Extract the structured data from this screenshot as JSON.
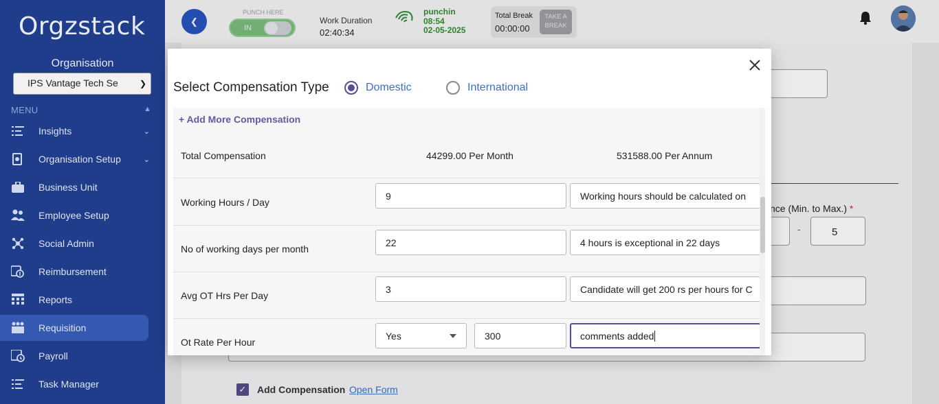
{
  "sidebar": {
    "logo": "Orgzstack",
    "org_label": "Organisation",
    "org_select_value": "IPS Vantage Tech Se",
    "menu_label": "MENU",
    "items": [
      {
        "label": "Insights",
        "icon": "list-icon",
        "has_chevron": true
      },
      {
        "label": "Organisation Setup",
        "icon": "org-setup-icon",
        "has_chevron": true
      },
      {
        "label": "Business Unit",
        "icon": "briefcase-icon",
        "has_chevron": false
      },
      {
        "label": "Employee Setup",
        "icon": "people-icon",
        "has_chevron": false
      },
      {
        "label": "Social Admin",
        "icon": "social-icon",
        "has_chevron": false
      },
      {
        "label": "Reimbursement",
        "icon": "reimbursement-icon",
        "has_chevron": false
      },
      {
        "label": "Reports",
        "icon": "grid-icon",
        "has_chevron": false
      },
      {
        "label": "Requisition",
        "icon": "requisition-icon",
        "has_chevron": false,
        "active": true
      },
      {
        "label": "Payroll",
        "icon": "payroll-icon",
        "has_chevron": false
      },
      {
        "label": "Task Manager",
        "icon": "task-icon",
        "has_chevron": false
      }
    ]
  },
  "header": {
    "punch_label": "PUNCH HERE",
    "punch_state": "IN",
    "work_duration_label": "Work Duration",
    "work_duration_value": "02:40:34",
    "punchin_label": "punchin",
    "punchin_time": "08:54",
    "punchin_date": "02-05-2025",
    "total_break_label": "Total Break",
    "total_break_value": "00:00:00",
    "take_break_line1": "TAKE A",
    "take_break_line2": "BREAK"
  },
  "background": {
    "range_label": "nce (Min. to Max.)",
    "range_required": "*",
    "range_separator": "-",
    "range_max": "5",
    "add_compensation_label": "Add Compensation",
    "open_form_link": "Open Form"
  },
  "modal": {
    "title": "Select Compensation Type",
    "options": [
      {
        "label": "Domestic",
        "selected": true
      },
      {
        "label": "International",
        "selected": false
      }
    ],
    "add_more": "+ Add More Compensation",
    "total": {
      "label": "Total Compensation",
      "per_month": "44299.00 Per Month",
      "per_annum": "531588.00 Per Annum"
    },
    "rows": [
      {
        "label": "Working Hours / Day",
        "value": "9",
        "comment": "Working hours should be calculated on"
      },
      {
        "label": "No of working days per month",
        "value": "22",
        "comment": "4 hours is exceptional in 22 days"
      },
      {
        "label": "Avg OT Hrs Per Day",
        "value": "3",
        "comment": "Candidate will get 200 rs per hours for C"
      },
      {
        "label": "Ot Rate Per Hour",
        "select_value": "Yes",
        "value": "300",
        "comment": "comments added"
      }
    ]
  },
  "colors": {
    "sidebar_bg": "#1f3d8a",
    "active_item_bg": "#3558b0",
    "accent_purple": "#5d4a96",
    "link_blue": "#3f6fc4",
    "punch_green": "#2f8f2f"
  }
}
